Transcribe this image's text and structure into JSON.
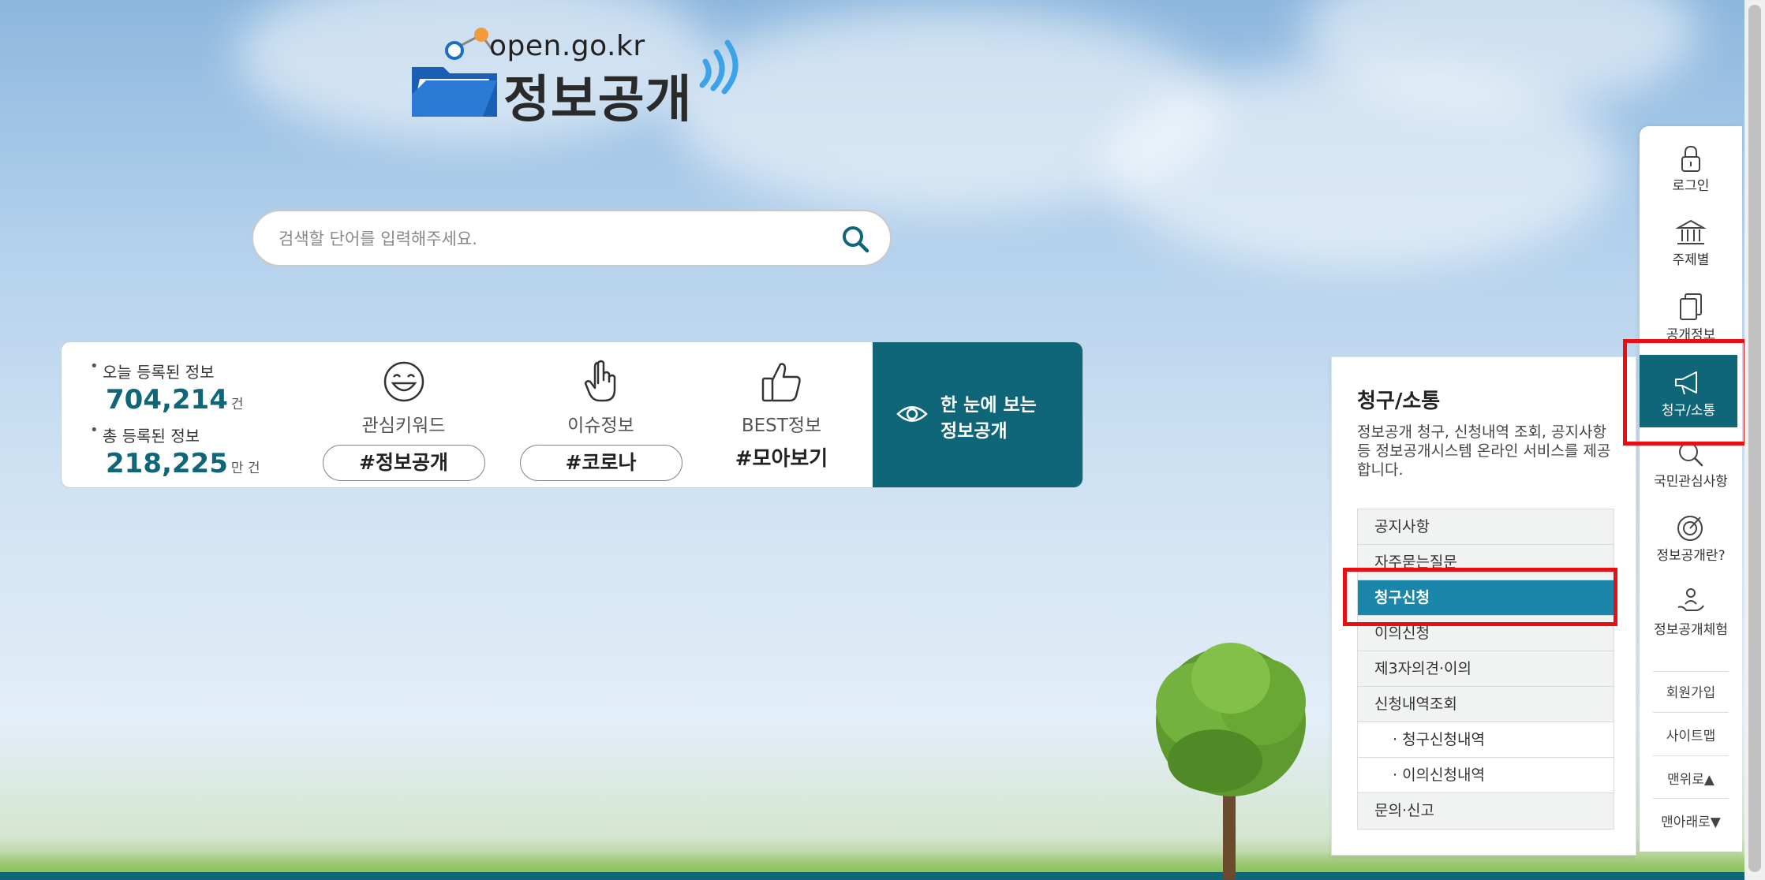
{
  "logo": {
    "domain": "open.go.kr",
    "title": "정보공개"
  },
  "search": {
    "placeholder": "검색할 단어를 입력해주세요."
  },
  "stats": {
    "today_label": "오늘 등록된 정보",
    "today_value": "704,214",
    "today_unit": "건",
    "total_label": "총 등록된 정보",
    "total_value": "218,225",
    "total_unit": "만 건"
  },
  "keywords": [
    {
      "icon": "smile-face-icon",
      "label": "관심키워드",
      "tag": "#정보공개"
    },
    {
      "icon": "pointing-hand-icon",
      "label": "이슈정보",
      "tag": "#코로나"
    },
    {
      "icon": "thumbs-up-icon",
      "label": "BEST정보",
      "tag": "#모아보기"
    }
  ],
  "cta": {
    "icon": "eye-icon",
    "text": "한 눈에 보는\n정보공개"
  },
  "dropdown": {
    "title": "청구/소통",
    "description": "정보공개 청구, 신청내역 조회, 공지사항 등 정보공개시스템 온라인 서비스를 제공합니다.",
    "items": [
      {
        "label": "공지사항",
        "active": false,
        "sub": false
      },
      {
        "label": "자주묻는질문",
        "active": false,
        "sub": false
      },
      {
        "label": "청구신청",
        "active": true,
        "sub": false
      },
      {
        "label": "이의신청",
        "active": false,
        "sub": false
      },
      {
        "label": "제3자의견·이의",
        "active": false,
        "sub": false
      },
      {
        "label": "신청내역조회",
        "active": false,
        "sub": false
      },
      {
        "label": "· 청구신청내역",
        "active": false,
        "sub": true
      },
      {
        "label": "· 이의신청내역",
        "active": false,
        "sub": true
      },
      {
        "label": "문의·신고",
        "active": false,
        "sub": false
      }
    ]
  },
  "quick_nav": {
    "items": [
      {
        "icon": "lock-icon",
        "label": "로그인"
      },
      {
        "icon": "building-icon",
        "label": "주제별"
      },
      {
        "icon": "document-icon",
        "label": "공개정보"
      },
      {
        "icon": "megaphone-icon",
        "label": "청구/소통",
        "active": true
      },
      {
        "icon": "magnifier-icon",
        "label": "국민관심사항"
      },
      {
        "icon": "target-icon",
        "label": "정보공개란?"
      },
      {
        "icon": "hand-person-icon",
        "label": "정보공개체험"
      }
    ],
    "links": [
      "회원가입",
      "사이트맵",
      "맨위로▲",
      "맨아래로▼"
    ]
  },
  "colors": {
    "primary": "#0e6678",
    "active_menu": "#1a86a9",
    "highlight": "#e80e12"
  }
}
